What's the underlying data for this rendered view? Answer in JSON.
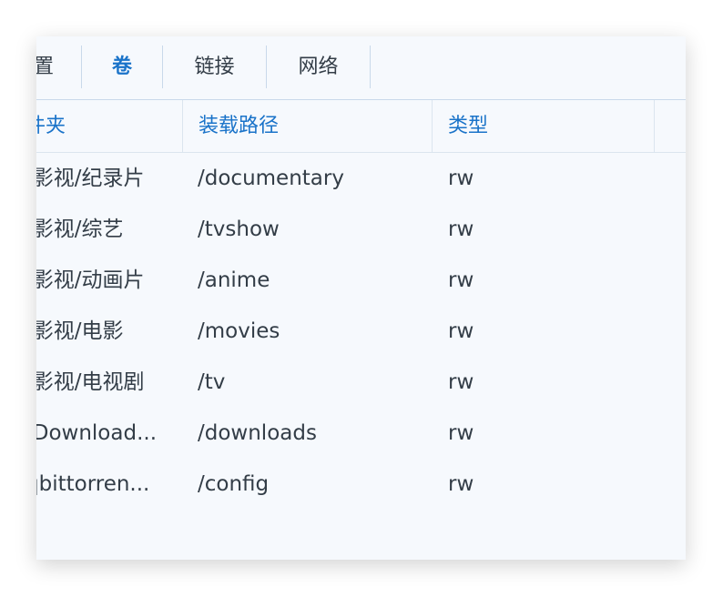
{
  "tabs": [
    {
      "label": "置"
    },
    {
      "label": "卷"
    },
    {
      "label": "链接"
    },
    {
      "label": "网络"
    }
  ],
  "active_tab": "卷",
  "columns": [
    "件夹",
    "装载路径",
    "类型"
  ],
  "rows": [
    {
      "folder": "/影视/纪录片",
      "mount_path": "/documentary",
      "type": "rw"
    },
    {
      "folder": "/影视/综艺",
      "mount_path": "/tvshow",
      "type": "rw"
    },
    {
      "folder": "/影视/动画片",
      "mount_path": "/anime",
      "type": "rw"
    },
    {
      "folder": "/影视/电影",
      "mount_path": "/movies",
      "type": "rw"
    },
    {
      "folder": "/影视/电视剧",
      "mount_path": "/tv",
      "type": "rw"
    },
    {
      "folder": "/Download...",
      "mount_path": "/downloads",
      "type": "rw"
    },
    {
      "folder": "qbittorren...",
      "mount_path": "/config",
      "type": "rw"
    }
  ],
  "colors": {
    "accent": "#1a73c9",
    "text": "#333d47",
    "panel_bg": "#f6f9fd",
    "divider": "#c9d9ea"
  }
}
